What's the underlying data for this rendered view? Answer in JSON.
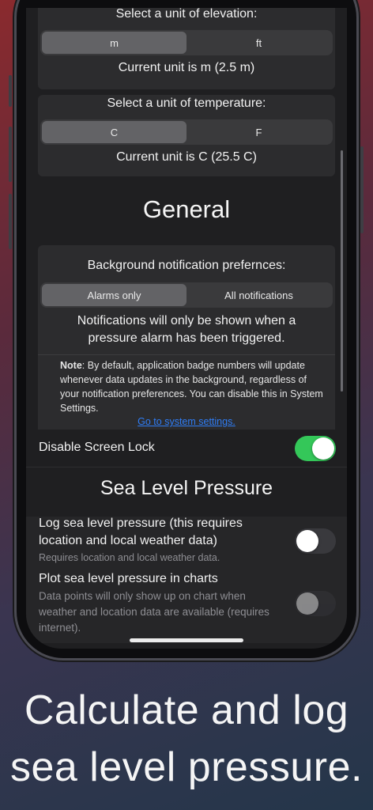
{
  "elevation": {
    "title": "Select a unit of elevation:",
    "options": [
      "m",
      "ft"
    ],
    "selected": "m",
    "current": "Current unit is m (2.5 m)"
  },
  "temperature": {
    "title": "Select a unit of temperature:",
    "options": [
      "C",
      "F"
    ],
    "selected": "C",
    "current": "Current unit is C (25.5 C)"
  },
  "general": {
    "header": "General",
    "notif_title": "Background notification prefernces:",
    "notif_options": [
      "Alarms only",
      "All notifications"
    ],
    "notif_selected": "Alarms only",
    "notif_message": "Notifications will only be shown when a pressure alarm has been triggered.",
    "note_label": "Note",
    "note_text": ": By default, application badge numbers will update whenever data updates in the background, regardless of your notification preferences. You can disable this in System Settings.",
    "settings_link": "Go to system settings.",
    "screen_lock_label": "Disable Screen Lock",
    "screen_lock_on": true
  },
  "sea_level": {
    "header": "Sea Level Pressure",
    "log_label": "Log sea level pressure (this requires location and local weather data)",
    "log_hint": "Requires location and local weather data.",
    "log_on": false,
    "plot_label": "Plot sea level pressure in charts",
    "plot_hint": "Data points will only show up on chart when weather and location data are available (requires internet).",
    "plot_on": false
  },
  "caption": "Calculate and log sea level pressure.",
  "colors": {
    "toggle_on": "#34c759",
    "link": "#2f7df6"
  }
}
